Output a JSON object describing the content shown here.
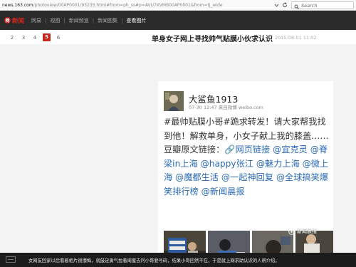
{
  "browser": {
    "url_domain": "news.163.com",
    "url_path": "/photoview/00AP0001/95235.html#from=ph_ss#p=AVU7KVMB00AP0001&from=tj_wide",
    "search_placeholder": "Search"
  },
  "nav": {
    "logo_text": "新闻",
    "logo_mark": "网",
    "breadcrumb": [
      "网易",
      "视图",
      "新闻频道",
      "新闻图集",
      "查看图片"
    ]
  },
  "pager": {
    "pages": [
      "2",
      "3",
      "4",
      "5",
      "6"
    ],
    "current": "5"
  },
  "article": {
    "title": "单身女子网上寻找帅气贴膜小伙求认识",
    "date": "2015-08-01 11:02"
  },
  "weibo": {
    "user_name": "大鲨鱼1913",
    "meta": "07-30 12:47  来自微博 weibo.com",
    "text_plain": "#最帅贴膜小哥#跪求转发！请大家帮我找到他！解救单身，小女子献上我的膝盖……豆瓣原文链接：",
    "link_text": "网页链接",
    "mentions": "@宜克灵 @脊梁in上海 @happy张江 @魅力上海 @微上海 @魔都生活 @一起神回复 @全球搞笑爆笑排行榜 @新闻晨报",
    "watermark": "新闻晨报"
  },
  "caption": {
    "text": "女网友回家以后看着相片很懊悔，就鼓足勇气拉着闺蜜去问小哥要号码，结果小哥回然不在，于是就上网求助认识的人帮介绍。"
  },
  "colors": {
    "accent_red": "#c8261b",
    "nav_dark": "#2b2b2b",
    "link_blue": "#2a6ab5"
  }
}
